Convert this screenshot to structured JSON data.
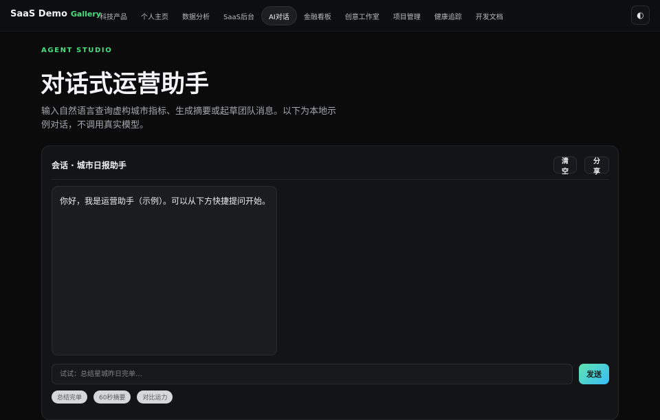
{
  "brand": {
    "name": "SaaS Demo",
    "accent": "Gallery"
  },
  "nav": {
    "items": [
      {
        "label": "科技产品"
      },
      {
        "label": "个人主页"
      },
      {
        "label": "数据分析"
      },
      {
        "label": "SaaS后台"
      },
      {
        "label": "AI对话",
        "active": true
      },
      {
        "label": "金融看板"
      },
      {
        "label": "创意工作室"
      },
      {
        "label": "项目管理"
      },
      {
        "label": "健康追踪"
      },
      {
        "label": "开发文档"
      }
    ],
    "theme_toggle_icon": "◐"
  },
  "hero": {
    "eyebrow": "AGENT STUDIO",
    "title": "对话式运营助手",
    "description": "输入自然语言查询虚构城市指标、生成摘要或起草团队消息。以下为本地示例对话，不调用真实模型。"
  },
  "chat": {
    "title": "会话 · 城市日报助手",
    "clear_label": "清空",
    "share_label": "分享",
    "messages": [
      {
        "role": "assistant",
        "text": "你好，我是运营助手（示例）。可以从下方快捷提问开始。"
      }
    ],
    "input": {
      "value": "",
      "placeholder": "试试：总结星城昨日完单…"
    },
    "send_label": "发送",
    "quick_prompts": [
      "总结完单",
      "60秒摘要",
      "对比运力"
    ]
  },
  "colors": {
    "accent": "#4ade80",
    "background": "#0b0b0c",
    "send_gradient_start": "#5fe3b0",
    "send_gradient_end": "#38bdf8"
  }
}
